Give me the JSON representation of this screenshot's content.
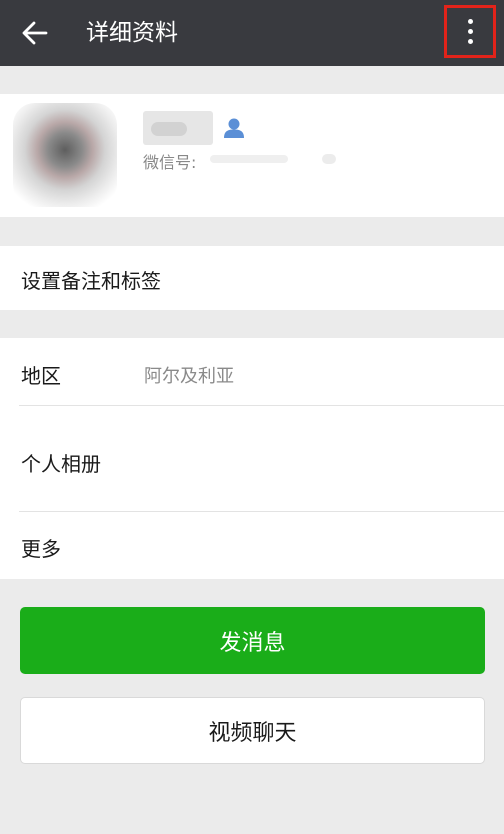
{
  "header": {
    "back_icon": "arrow-left-icon",
    "title": "详细资料",
    "more_icon": "more-vertical-icon",
    "highlight_color": "#e2231a"
  },
  "profile": {
    "avatar": "blurred-avatar",
    "contact_icon": "contact-person-icon",
    "wechat_id_label": "微信号:"
  },
  "remark": {
    "label": "设置备注和标签"
  },
  "info": {
    "region_label": "地区",
    "region_value": "阿尔及利亚",
    "album_label": "个人相册",
    "more_label": "更多"
  },
  "actions": {
    "send_message": "发消息",
    "video_chat": "视频聊天",
    "primary_color": "#1aad19"
  }
}
